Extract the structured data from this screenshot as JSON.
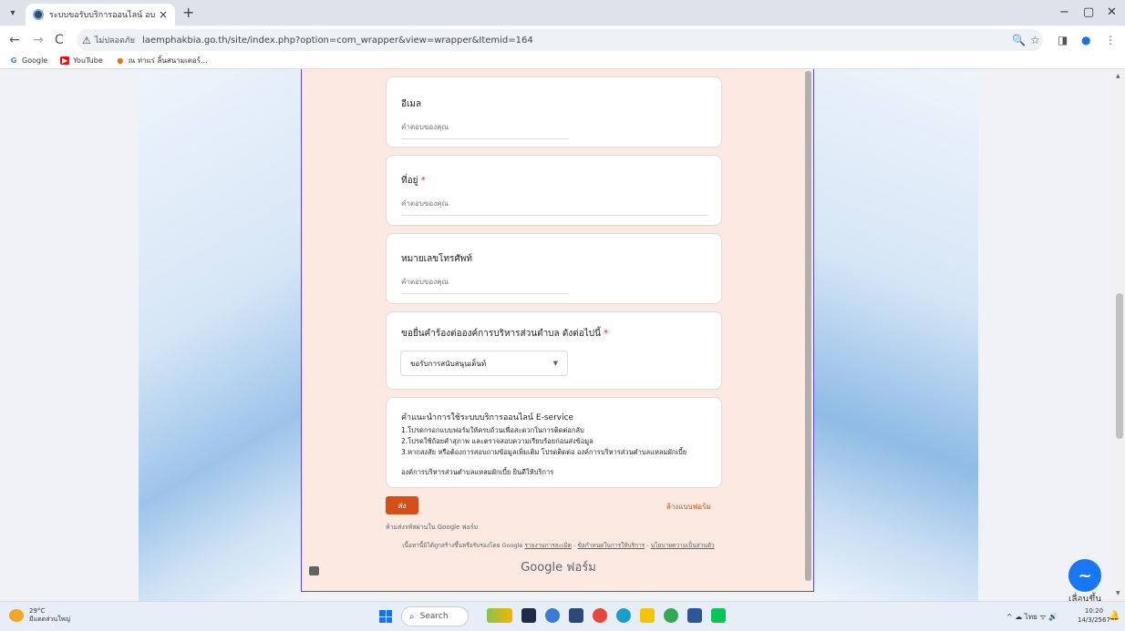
{
  "browser": {
    "tab_title": "ระบบขอรับบริการออนไลน์ อบต.แหลม",
    "tab_close": "×",
    "new_tab": "+",
    "menu": "▾",
    "minimize": "−",
    "maximize": "▢",
    "close": "✕",
    "back": "←",
    "forward": "→",
    "reload": "C",
    "not_secure": "ไม่ปลอดภัย",
    "url": "laemphakbia.go.th/site/index.php?option=com_wrapper&view=wrapper&Itemid=164",
    "zoom_icon": "🔍",
    "star_icon": "☆",
    "sidepanel_icon": "◨",
    "profile_icon": "●",
    "more_icon": "⋮"
  },
  "bookmarks": [
    {
      "label": "Google",
      "icon": "G",
      "color": "#4285f4"
    },
    {
      "label": "YouTube",
      "icon": "▶",
      "color": "#ff0000"
    },
    {
      "label": "ณ ท่าแร่ ลิ้นสนามเตอร์...",
      "icon": "●",
      "color": "#e8710a"
    }
  ],
  "form": {
    "email": {
      "label": "อีเมล",
      "placeholder": "คำตอบของคุณ"
    },
    "address": {
      "label": "ที่อยู่",
      "required": "*",
      "placeholder": "คำตอบของคุณ"
    },
    "phone": {
      "label": "หมายเลขโทรศัพท์",
      "placeholder": "คำตอบของคุณ"
    },
    "request": {
      "label": "ขอยื่นคำร้องต่อองค์การบริหารส่วนตำบล ดังต่อไปนี้",
      "required": "*",
      "selected": "ขอรับการสนับสนุนเต็นท์",
      "caret": "▼"
    },
    "info": {
      "title": "คำแนะนำการใช้ระบบบริการออนไลน์ E-service",
      "lines": [
        "1.โปรดกรอกแบบฟอร์มให้ครบถ้วนเพื่อสะดวกในการติดต่อกลับ",
        "2.โปรดใช้ถ้อยคำสุภาพ และตรวจสอบความเรียบร้อยก่อนส่งข้อมูล",
        "3.หากสงสัย หรือต้องการสอบถามข้อมูลเพิ่มเติม โปรดติดต่อ องค์การบริหารส่วนตำบลแหลมผักเบี้ย",
        "องค์การบริหารส่วนตำบลแหลมผักเบี้ย ยินดีให้บริการ"
      ]
    },
    "submit": "ส่ง",
    "clear": "ล้างแบบฟอร์ม",
    "never_password": "ห้ามส่งรหัสผ่านใน Google ฟอร์ม",
    "disclaimer_prefix": "เนื้อหานี้มิได้ถูกสร้างขึ้นหรือรับรองโดย Google",
    "disclaimer_links": [
      "รายงานการละเมิด",
      "ข้อกำหนดในการให้บริการ",
      "นโยบายความเป็นส่วนตัว"
    ],
    "brand": "Google",
    "brand_suffix": "ฟอร์ม"
  },
  "messenger": {
    "label": "เลื่อนขึ้น",
    "icon": "~"
  },
  "taskbar": {
    "temp": "29°C",
    "weather": "มีแดดส่วนใหญ่",
    "search": "Search",
    "tray": "^  ☁  ไทย  ᯤ  🔊",
    "time": "10:20",
    "date": "14/3/2567",
    "notif_icon": "🔔"
  }
}
